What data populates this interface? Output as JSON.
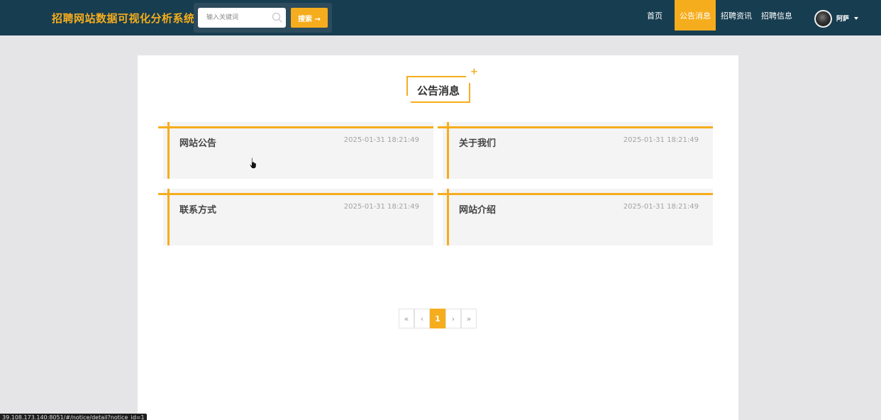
{
  "header": {
    "brand": "招聘网站数据可视化分析系统",
    "search": {
      "placeholder": "输入关键词",
      "button_label": "搜索 →"
    },
    "nav": {
      "home": "首页",
      "notice": "公告消息",
      "news": "招聘资讯",
      "jobs": "招聘信息"
    },
    "user": {
      "name": "阿萨"
    }
  },
  "main": {
    "section_title": "公告消息",
    "cards": [
      {
        "title": "网站公告",
        "time": "2025-01-31 18:21:49"
      },
      {
        "title": "关于我们",
        "time": "2025-01-31 18:21:49"
      },
      {
        "title": "联系方式",
        "time": "2025-01-31 18:21:49"
      },
      {
        "title": "网站介绍",
        "time": "2025-01-31 18:21:49"
      }
    ],
    "pagination": {
      "first": "«",
      "prev": "‹",
      "current": "1",
      "next": "›",
      "last": "»"
    }
  },
  "statusbar": {
    "url": "39.108.173.140:8051/#/notice/detail?notice_id=1"
  },
  "colors": {
    "accent": "#f6ad1d",
    "header_bg": "#173d50",
    "page_bg": "#e5e5e7",
    "card_bg": "#f4f4f4"
  }
}
